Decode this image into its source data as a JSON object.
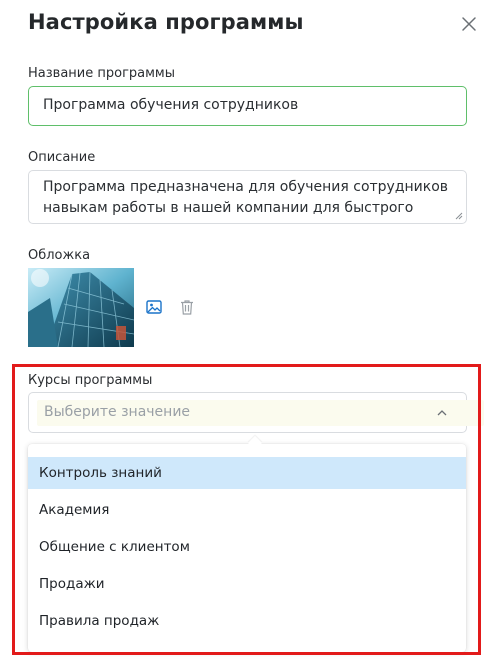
{
  "dialog": {
    "title": "Настройка программы"
  },
  "name_field": {
    "label": "Название программы",
    "value": "Программа обучения сотрудников"
  },
  "description_field": {
    "label": "Описание",
    "line1": "Программа предназначена для обучения сотрудников",
    "line2": "навыкам работы в нашей компании для быстрого роста и"
  },
  "cover": {
    "label": "Обложка",
    "actions": [
      "image-icon",
      "trash-icon"
    ]
  },
  "courses": {
    "label": "Курсы программы",
    "placeholder": "Выберите значение",
    "options": [
      "Контроль знаний",
      "Академия",
      "Общение с клиентом",
      "Продажи",
      "Правила продаж"
    ],
    "active_index": 0
  },
  "colors": {
    "focus_border": "#5fbf6a",
    "option_highlight": "#cfe8fb",
    "annotation_box": "#e21a1a"
  }
}
